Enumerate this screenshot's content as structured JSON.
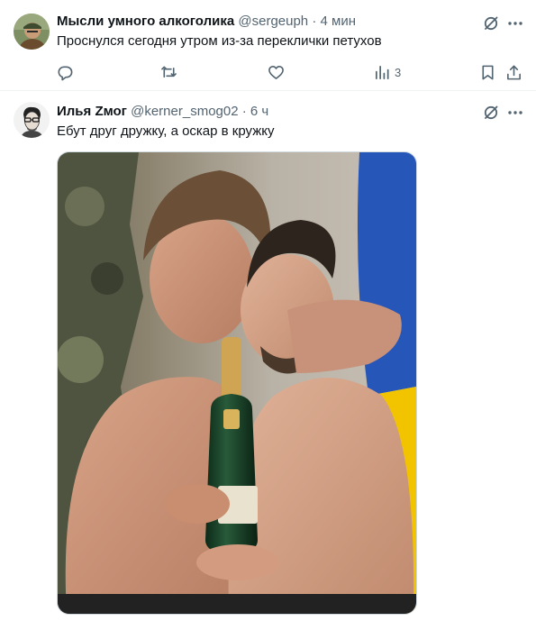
{
  "tweets": [
    {
      "author_name": "Мысли умного алкоголика",
      "handle": "@sergeuph",
      "separator": "·",
      "time": "4 мин",
      "text": "Проснулся сегодня утром из-за переклички петухов",
      "views_count": "3",
      "icons": [
        "grok-icon",
        "more-icon",
        "reply-icon",
        "retweet-icon",
        "like-icon",
        "views-icon",
        "bookmark-icon",
        "share-icon"
      ]
    },
    {
      "author_name": "Илья Zмог",
      "handle": "@kerner_smog02",
      "separator": "·",
      "time": "6 ч",
      "text": "Ебут друг дружку, а оскар в кружку",
      "media": "photo",
      "icons": [
        "grok-icon",
        "more-icon"
      ]
    }
  ],
  "colors": {
    "text_primary": "#0f1419",
    "text_secondary": "#536471",
    "divider": "#eff3f4"
  }
}
